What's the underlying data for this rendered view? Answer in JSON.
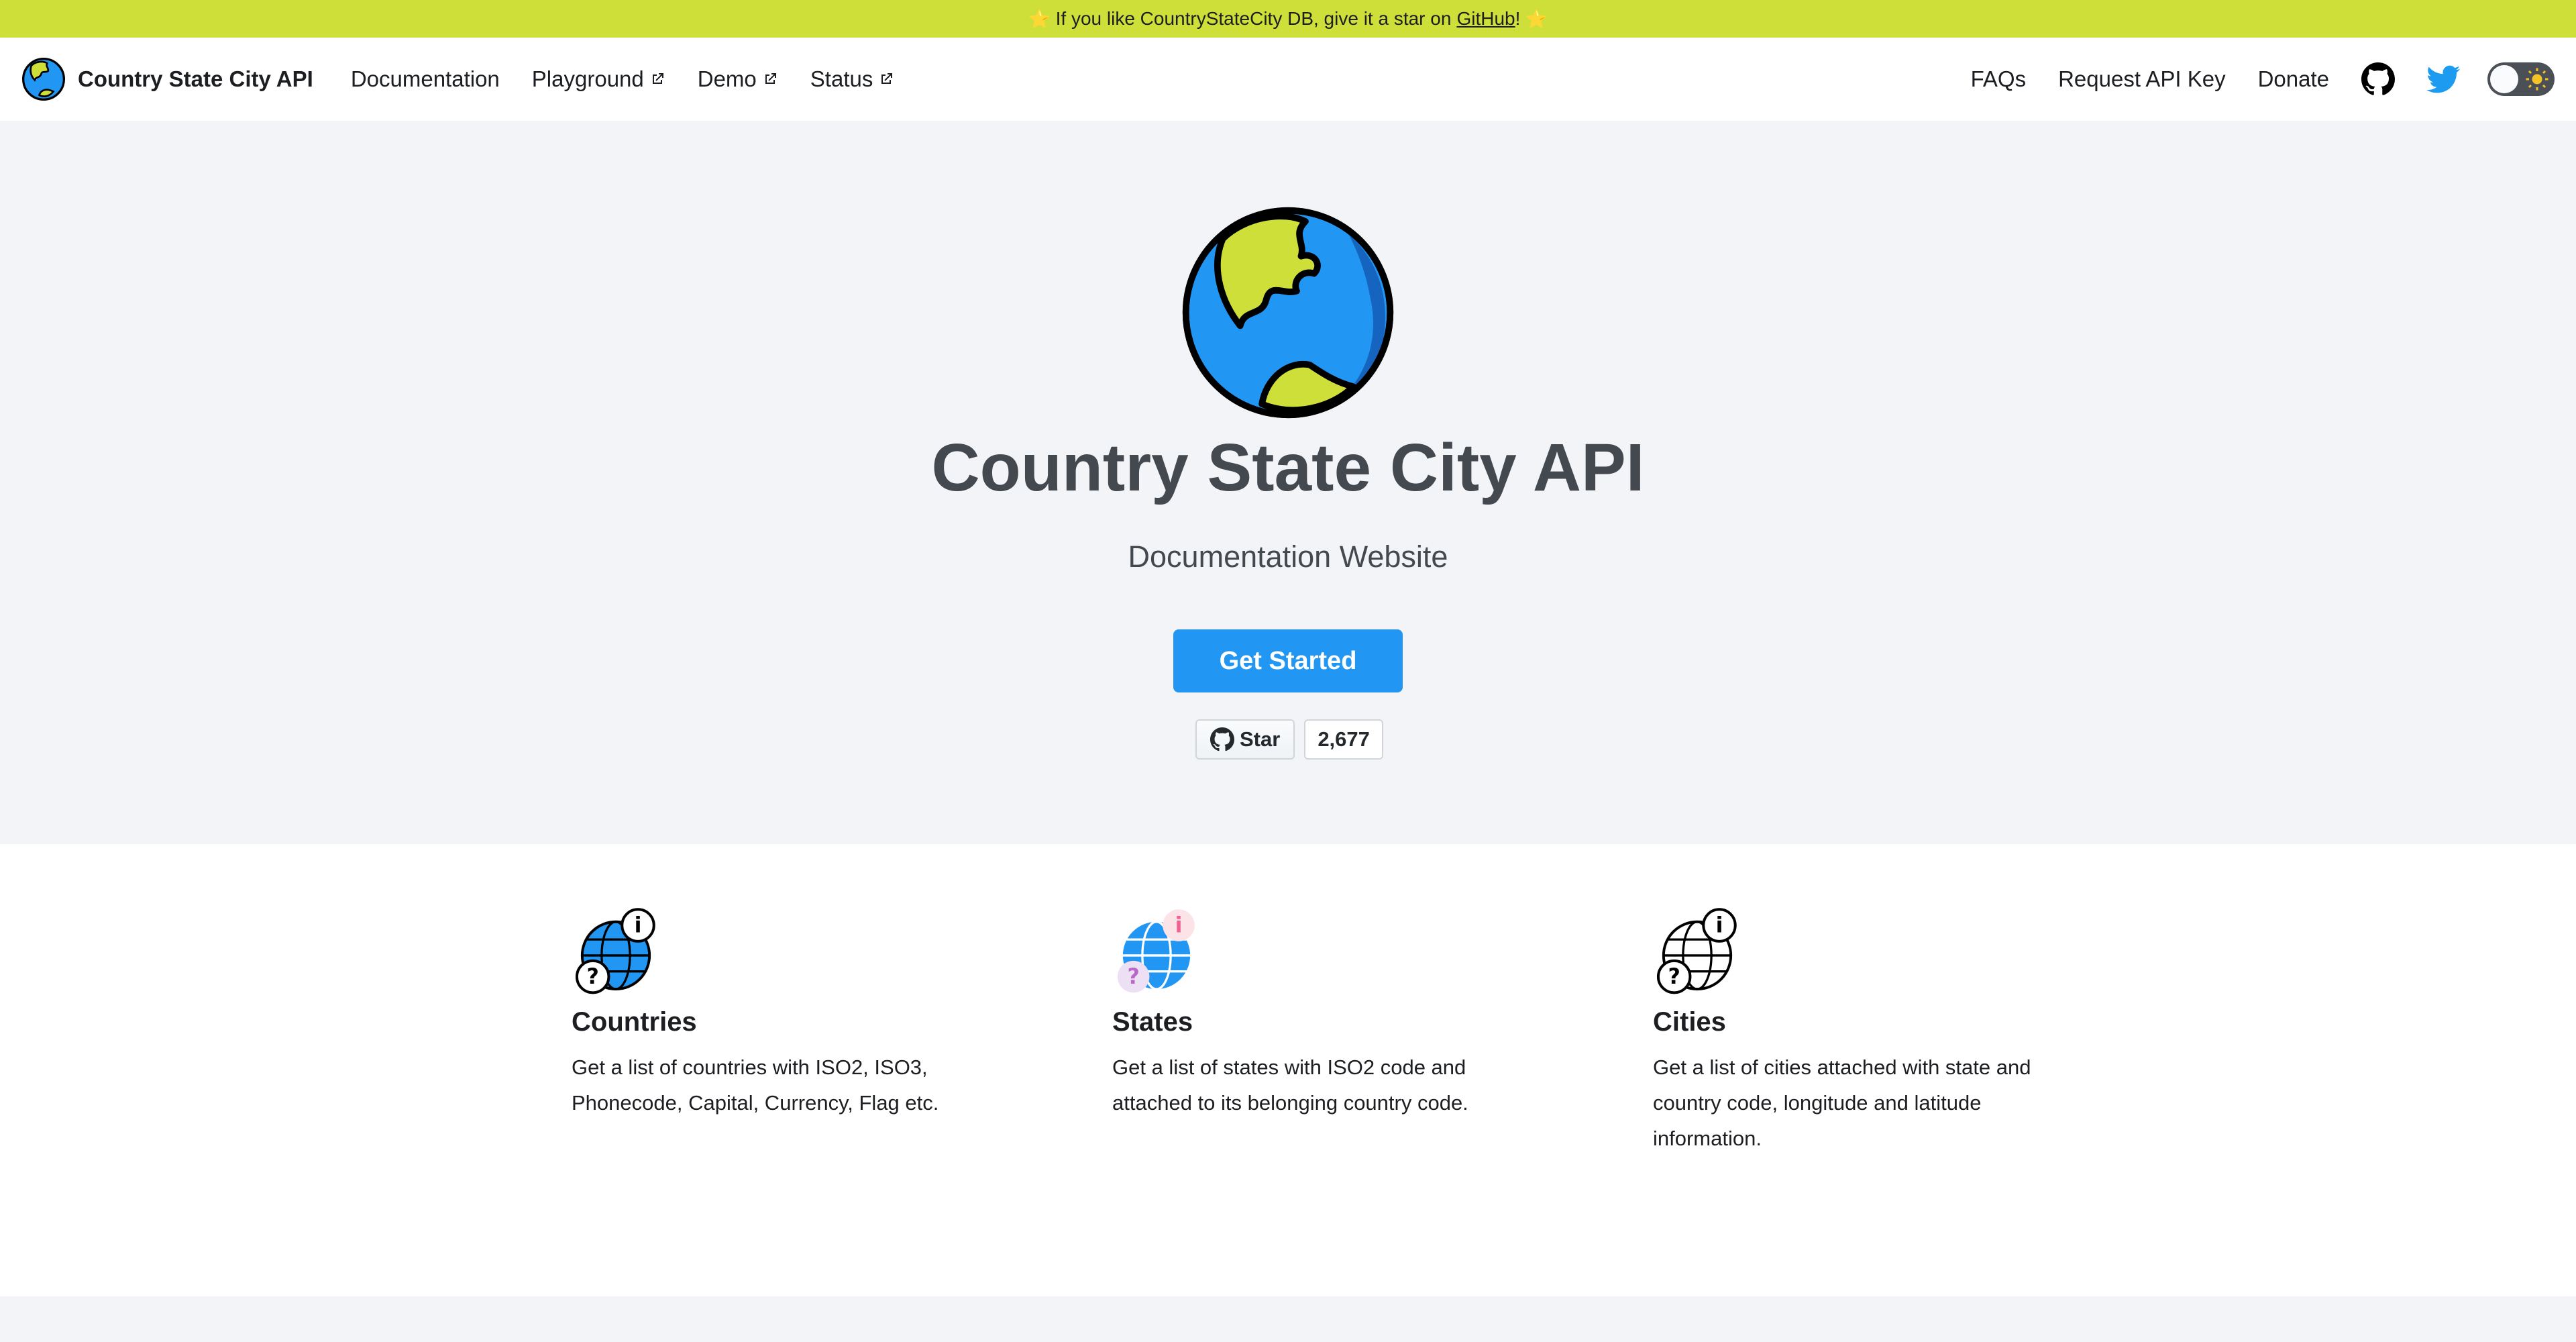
{
  "announcement": {
    "star_left": "⭐",
    "prefix": "If you like CountryStateCity DB, give it a star on",
    "link_text": "GitHub",
    "suffix": "!",
    "star_right": "⭐"
  },
  "navbar": {
    "brand": "Country State City API",
    "links": [
      "Documentation",
      "Playground",
      "Demo",
      "Status"
    ],
    "right_links": [
      "FAQs",
      "Request API Key",
      "Donate"
    ],
    "icons": [
      "github-icon",
      "twitter-icon",
      "theme-toggle"
    ]
  },
  "hero": {
    "title": "Country State City API",
    "subtitle": "Documentation Website",
    "cta": "Get Started",
    "github_star": {
      "label": "Star",
      "count": "2,677"
    }
  },
  "features": [
    {
      "title": "Countries",
      "description": "Get a list of countries with ISO2, ISO3, Phonecode, Capital, Currency, Flag etc.",
      "icon": "countries-globe-info-icon"
    },
    {
      "title": "States",
      "description": "Get a list of states with ISO2 code and attached to its belonging country code.",
      "icon": "states-globe-info-icon"
    },
    {
      "title": "Cities",
      "description": "Get a list of cities attached with state and country code, longitude and latitude information.",
      "icon": "cities-globe-info-icon"
    }
  ],
  "colors": {
    "announcement_bg": "#cfdf3a",
    "primary": "#2196f3",
    "hero_bg": "#f2f4f8",
    "globe_land": "#cfdf3a",
    "globe_water": "#2196f3"
  }
}
